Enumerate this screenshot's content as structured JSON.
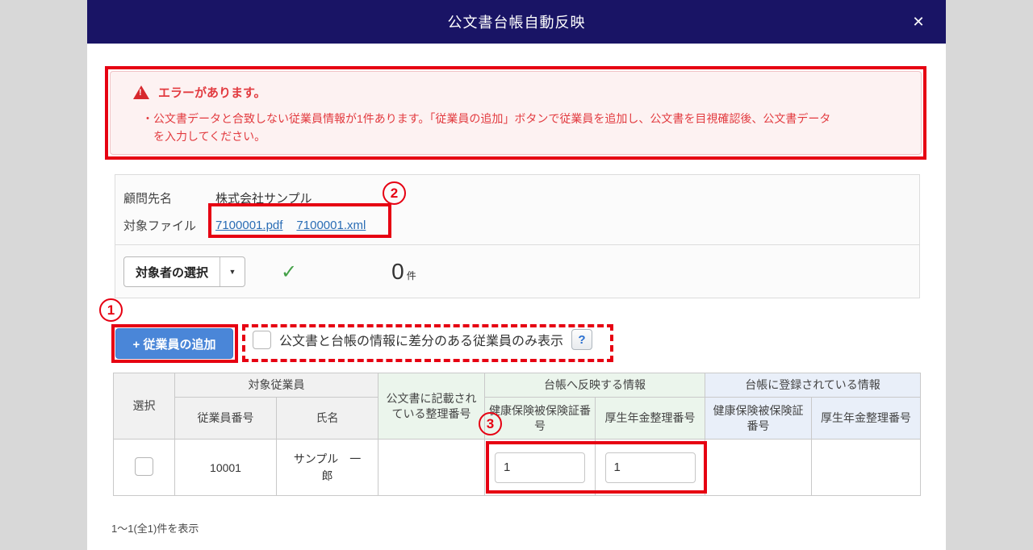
{
  "dialog": {
    "title": "公文書台帳自動反映",
    "close_icon": "✕"
  },
  "error": {
    "title": "エラーがあります。",
    "warning_glyph": "!",
    "message": "・公文書データと合致しない従業員情報が1件あります。「従業員の追加」ボタンで従業員を追加し、公文書を目視確認後、公文書データを入力してください。"
  },
  "info": {
    "client_label": "顧問先名",
    "client_value": "株式会社サンプル",
    "files_label": "対象ファイル",
    "files": [
      "7100001.pdf",
      "7100001.xml"
    ],
    "target_select_label": "対象者の選択",
    "caret_icon": "▼",
    "check_icon": "✓",
    "count_value": "0",
    "count_unit": "件"
  },
  "actions": {
    "add_employee_label": "+ 従業員の追加",
    "filter_checkbox_label": "公文書と台帳の情報に差分のある従業員のみ表示",
    "help_icon": "?"
  },
  "table": {
    "select_header": "選択",
    "groups": {
      "target": "対象従業員",
      "reflect": "台帳へ反映する情報",
      "registered": "台帳に登録されている情報"
    },
    "cols": {
      "employee_no": "従業員番号",
      "name": "氏名",
      "doc_ref": "公文書に記載されている整理番号",
      "health": "健康保険被保険証番号",
      "pension": "厚生年金整理番号"
    },
    "rows": [
      {
        "employee_no": "10001",
        "name": "サンプル　一郎",
        "doc_ref": "",
        "reflect_health": "1",
        "reflect_pension": "1",
        "registered_health": "",
        "registered_pension": ""
      }
    ],
    "footer": "1〜1(全1)件を表示"
  },
  "annotations": {
    "step1": "1",
    "step2": "2",
    "step3": "3"
  },
  "colors": {
    "header_navy": "#191465",
    "annotation_red": "#e60012",
    "error_red": "#e23a3f",
    "button_blue": "#4a86d8",
    "link_blue": "#2a6db5",
    "check_green": "#43a047"
  }
}
